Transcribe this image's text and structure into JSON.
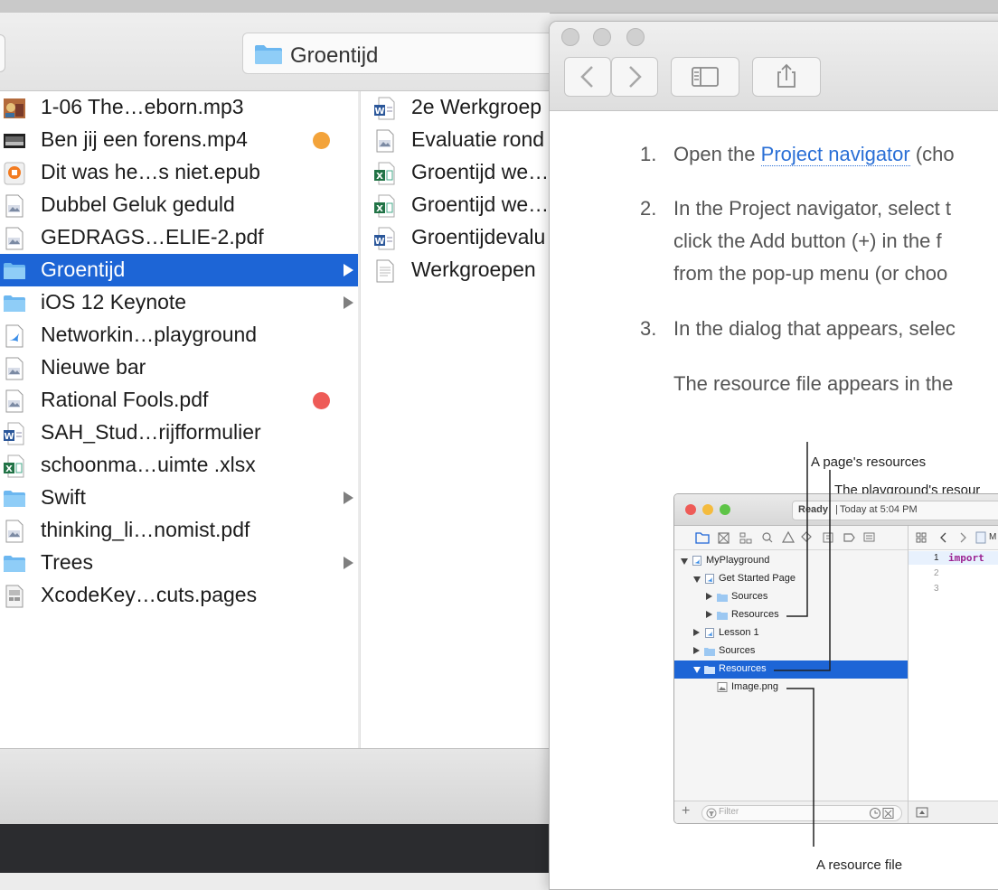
{
  "finder": {
    "path_title": "Groentijd",
    "column1": [
      {
        "label": "1-06 The…eborn.mp3",
        "icon": "music-file-icon"
      },
      {
        "label": "Ben jij een forens.mp4",
        "icon": "video-file-icon",
        "tag": "#f3a33a"
      },
      {
        "label": "Dit was he…s niet.epub",
        "icon": "epub-file-icon"
      },
      {
        "label": "Dubbel Geluk geduld",
        "icon": "document-file-icon"
      },
      {
        "label": "GEDRAGS…ELIE-2.pdf",
        "icon": "pdf-file-icon"
      },
      {
        "label": "Groentijd",
        "icon": "folder-icon",
        "selected": true,
        "folder": true
      },
      {
        "label": "iOS 12 Keynote",
        "icon": "folder-icon",
        "folder": true
      },
      {
        "label": "Networkin…playground",
        "icon": "swift-playground-icon"
      },
      {
        "label": "Nieuwe bar",
        "icon": "document-file-icon"
      },
      {
        "label": "Rational Fools.pdf",
        "icon": "pdf-file-icon",
        "tag": "#ee5b57"
      },
      {
        "label": "SAH_Stud…rijfformulier",
        "icon": "word-file-icon"
      },
      {
        "label": "schoonma…uimte .xlsx",
        "icon": "excel-file-icon"
      },
      {
        "label": "Swift",
        "icon": "folder-icon",
        "folder": true
      },
      {
        "label": "thinking_li…nomist.pdf",
        "icon": "pdf-file-icon"
      },
      {
        "label": "Trees",
        "icon": "folder-icon",
        "folder": true
      },
      {
        "label": "XcodeKey…cuts.pages",
        "icon": "pages-file-icon"
      }
    ],
    "column2": [
      {
        "label": "2e Werkgroep",
        "icon": "word-file-icon"
      },
      {
        "label": "Evaluatie rond",
        "icon": "document-file-icon"
      },
      {
        "label": "Groentijd we…",
        "icon": "excel-file-icon"
      },
      {
        "label": "Groentijd we…",
        "icon": "excel-file-icon"
      },
      {
        "label": "Groentijdevalu",
        "icon": "word-file-icon"
      },
      {
        "label": "Werkgroepen",
        "icon": "text-file-icon"
      }
    ]
  },
  "help": {
    "steps": [
      {
        "num": "1.",
        "lines": [
          "Open the ",
          "Project navigator",
          " (cho"
        ]
      },
      {
        "num": "2.",
        "lines": [
          "In the Project navigator, select t",
          "click the Add button (+) in the f",
          "from the pop-up menu (or choo"
        ]
      },
      {
        "num": "3.",
        "lines": [
          "In the dialog that appears, selec"
        ]
      }
    ],
    "paragraph": "The resource file appears in the",
    "callouts": {
      "page_resources": "A page's resources",
      "playground_resources": "The playground's resour",
      "resource_file": "A resource file"
    },
    "xcode": {
      "status_bold": "Ready",
      "status_sep": " | ",
      "status_time": "Today at 5:04 PM",
      "breadcrumb_initial": "M",
      "tree": [
        {
          "label": "MyPlayground",
          "indent": 0,
          "tri": "d"
        },
        {
          "label": "Get Started Page",
          "indent": 1,
          "tri": "d"
        },
        {
          "label": "Sources",
          "indent": 2,
          "tri": "r"
        },
        {
          "label": "Resources",
          "indent": 2,
          "tri": "r"
        },
        {
          "label": "Lesson 1",
          "indent": 1,
          "tri": "r"
        },
        {
          "label": "Sources",
          "indent": 1,
          "tri": "r"
        },
        {
          "label": "Resources",
          "indent": 1,
          "tri": "d",
          "selected": true
        },
        {
          "label": "Image.png",
          "indent": 2,
          "tri": ""
        }
      ],
      "filter_placeholder": "Filter",
      "code_lines": [
        "1",
        "2",
        "3"
      ],
      "code_text": "import"
    }
  }
}
